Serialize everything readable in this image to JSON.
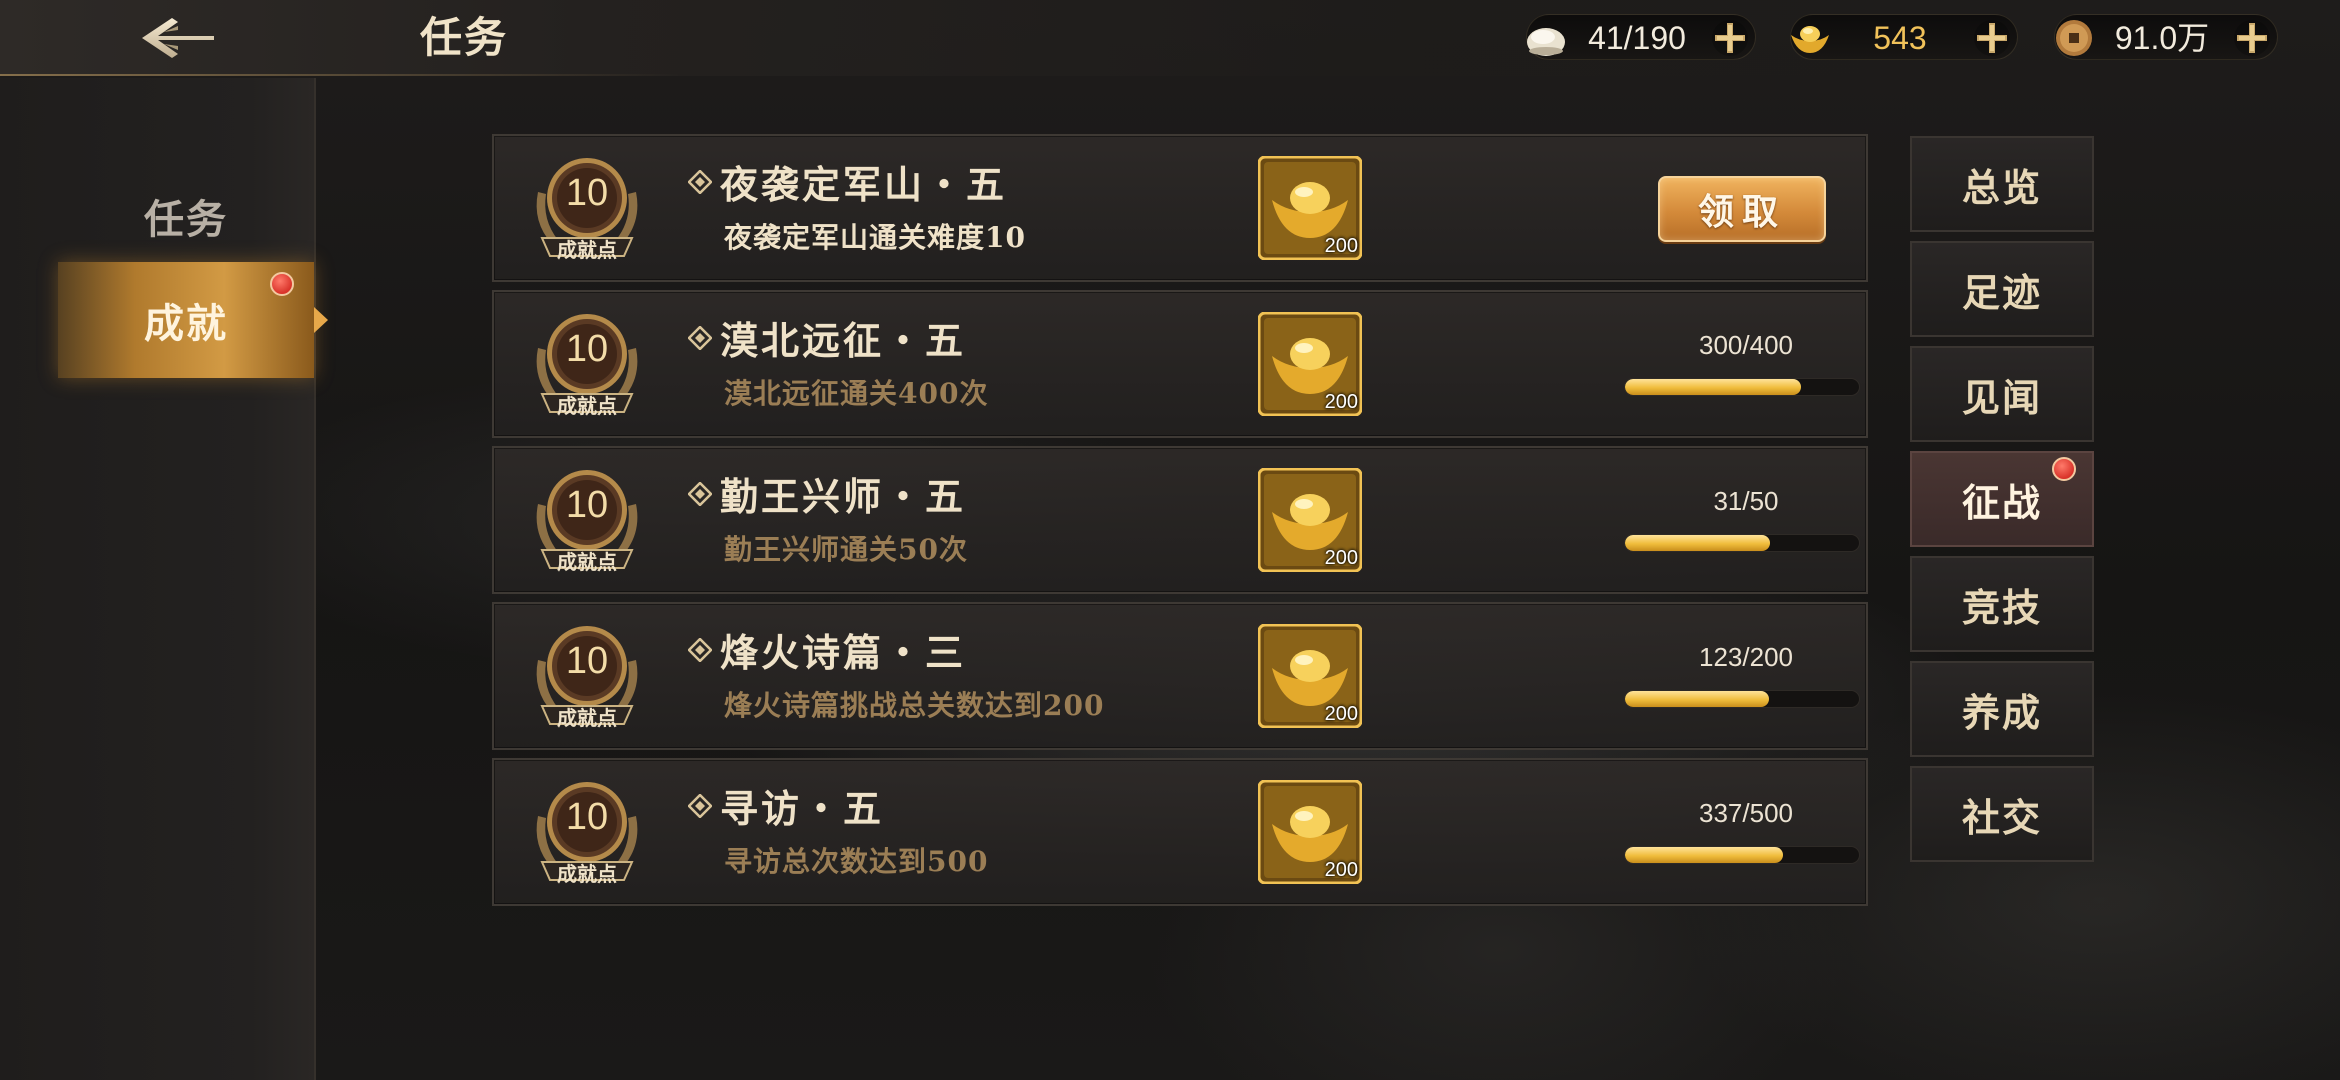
{
  "header": {
    "title": "任务",
    "resources": [
      {
        "icon": "bun-icon",
        "value": "41/190"
      },
      {
        "icon": "gold-ingot-icon",
        "value": "543"
      },
      {
        "icon": "copper-coin-icon",
        "value": "91.0万"
      }
    ]
  },
  "leftnav": {
    "items": [
      {
        "label": "任务",
        "active": false,
        "badge": false
      },
      {
        "label": "成就",
        "active": true,
        "badge": true
      }
    ]
  },
  "tasks": [
    {
      "points": "10",
      "points_label": "成就点",
      "title": "夜袭定军山・五",
      "desc": "夜袭定军山通关难度10",
      "reward_count": "200",
      "status": "claimable",
      "claim_label": "领取"
    },
    {
      "points": "10",
      "points_label": "成就点",
      "title": "漠北远征・五",
      "desc": "漠北远征通关400次",
      "reward_count": "200",
      "status": "progress",
      "progress_text": "300/400",
      "progress": 0.75
    },
    {
      "points": "10",
      "points_label": "成就点",
      "title": "勤王兴师・五",
      "desc": "勤王兴师通关50次",
      "reward_count": "200",
      "status": "progress",
      "progress_text": "31/50",
      "progress": 0.62
    },
    {
      "points": "10",
      "points_label": "成就点",
      "title": "烽火诗篇・三",
      "desc": "烽火诗篇挑战总关数达到200",
      "reward_count": "200",
      "status": "progress",
      "progress_text": "123/200",
      "progress": 0.615
    },
    {
      "points": "10",
      "points_label": "成就点",
      "title": "寻访・五",
      "desc": "寻访总次数达到500",
      "reward_count": "200",
      "status": "progress",
      "progress_text": "337/500",
      "progress": 0.674
    }
  ],
  "categories": [
    {
      "label": "总览",
      "active": false,
      "badge": false
    },
    {
      "label": "足迹",
      "active": false,
      "badge": false
    },
    {
      "label": "见闻",
      "active": false,
      "badge": false
    },
    {
      "label": "征战",
      "active": true,
      "badge": true
    },
    {
      "label": "竞技",
      "active": false,
      "badge": false
    },
    {
      "label": "养成",
      "active": false,
      "badge": false
    },
    {
      "label": "社交",
      "active": false,
      "badge": false
    }
  ],
  "colors": {
    "accent_gold": "#f0bd3c",
    "claim_button": "#d48a3a",
    "active_nav": "#d29a44",
    "badge_red": "#d9332a"
  }
}
